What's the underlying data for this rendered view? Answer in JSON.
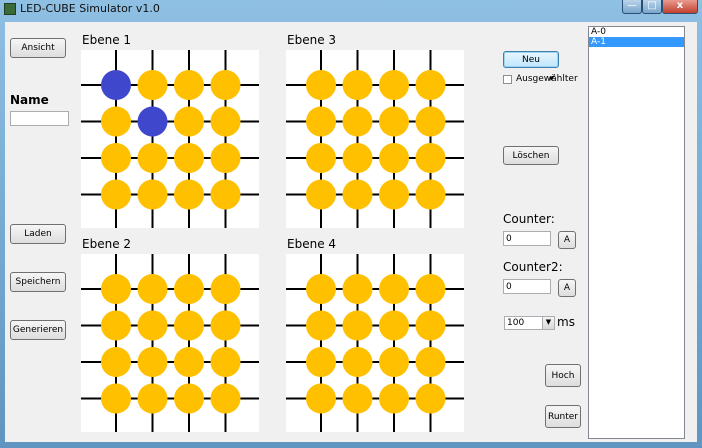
{
  "window": {
    "title": "LED-CUBE Simulator v1.0",
    "close_glyph": "x",
    "min_glyph": "",
    "max_glyph": ""
  },
  "left": {
    "ansicht": "Ansicht",
    "name_label": "Name",
    "name_value": "",
    "laden": "Laden",
    "speichern": "Speichern",
    "generieren": "Generieren"
  },
  "layers": [
    {
      "label": "Ebene 1",
      "leds": [
        [
          1,
          0,
          0,
          0
        ],
        [
          0,
          1,
          0,
          0
        ],
        [
          0,
          0,
          0,
          0
        ],
        [
          0,
          0,
          0,
          0
        ]
      ]
    },
    {
      "label": "Ebene 3",
      "leds": [
        [
          0,
          0,
          0,
          0
        ],
        [
          0,
          0,
          0,
          0
        ],
        [
          0,
          0,
          0,
          0
        ],
        [
          0,
          0,
          0,
          0
        ]
      ]
    },
    {
      "label": "Ebene 2",
      "leds": [
        [
          0,
          0,
          0,
          0
        ],
        [
          0,
          0,
          0,
          0
        ],
        [
          0,
          0,
          0,
          0
        ],
        [
          0,
          0,
          0,
          0
        ]
      ]
    },
    {
      "label": "Ebene 4",
      "leds": [
        [
          0,
          0,
          0,
          0
        ],
        [
          0,
          0,
          0,
          0
        ],
        [
          0,
          0,
          0,
          0
        ],
        [
          0,
          0,
          0,
          0
        ]
      ]
    }
  ],
  "colors": {
    "led_off": "#ffc000",
    "led_on": "#3f48cc",
    "grid_line": "#000000"
  },
  "right": {
    "neu": "Neu",
    "ausgewaehlter": "Ausgewählter",
    "loeschen": "Löschen",
    "counter_label": "Counter:",
    "counter_value": "0",
    "counter_btn": "A",
    "counter2_label": "Counter2:",
    "counter2_value": "0",
    "counter2_btn": "A",
    "speed_value": "100",
    "speed_unit": "ms",
    "hoch": "Hoch",
    "runter": "Runter"
  },
  "list": {
    "items": [
      "A-0",
      "A-1"
    ],
    "selected": 1
  }
}
